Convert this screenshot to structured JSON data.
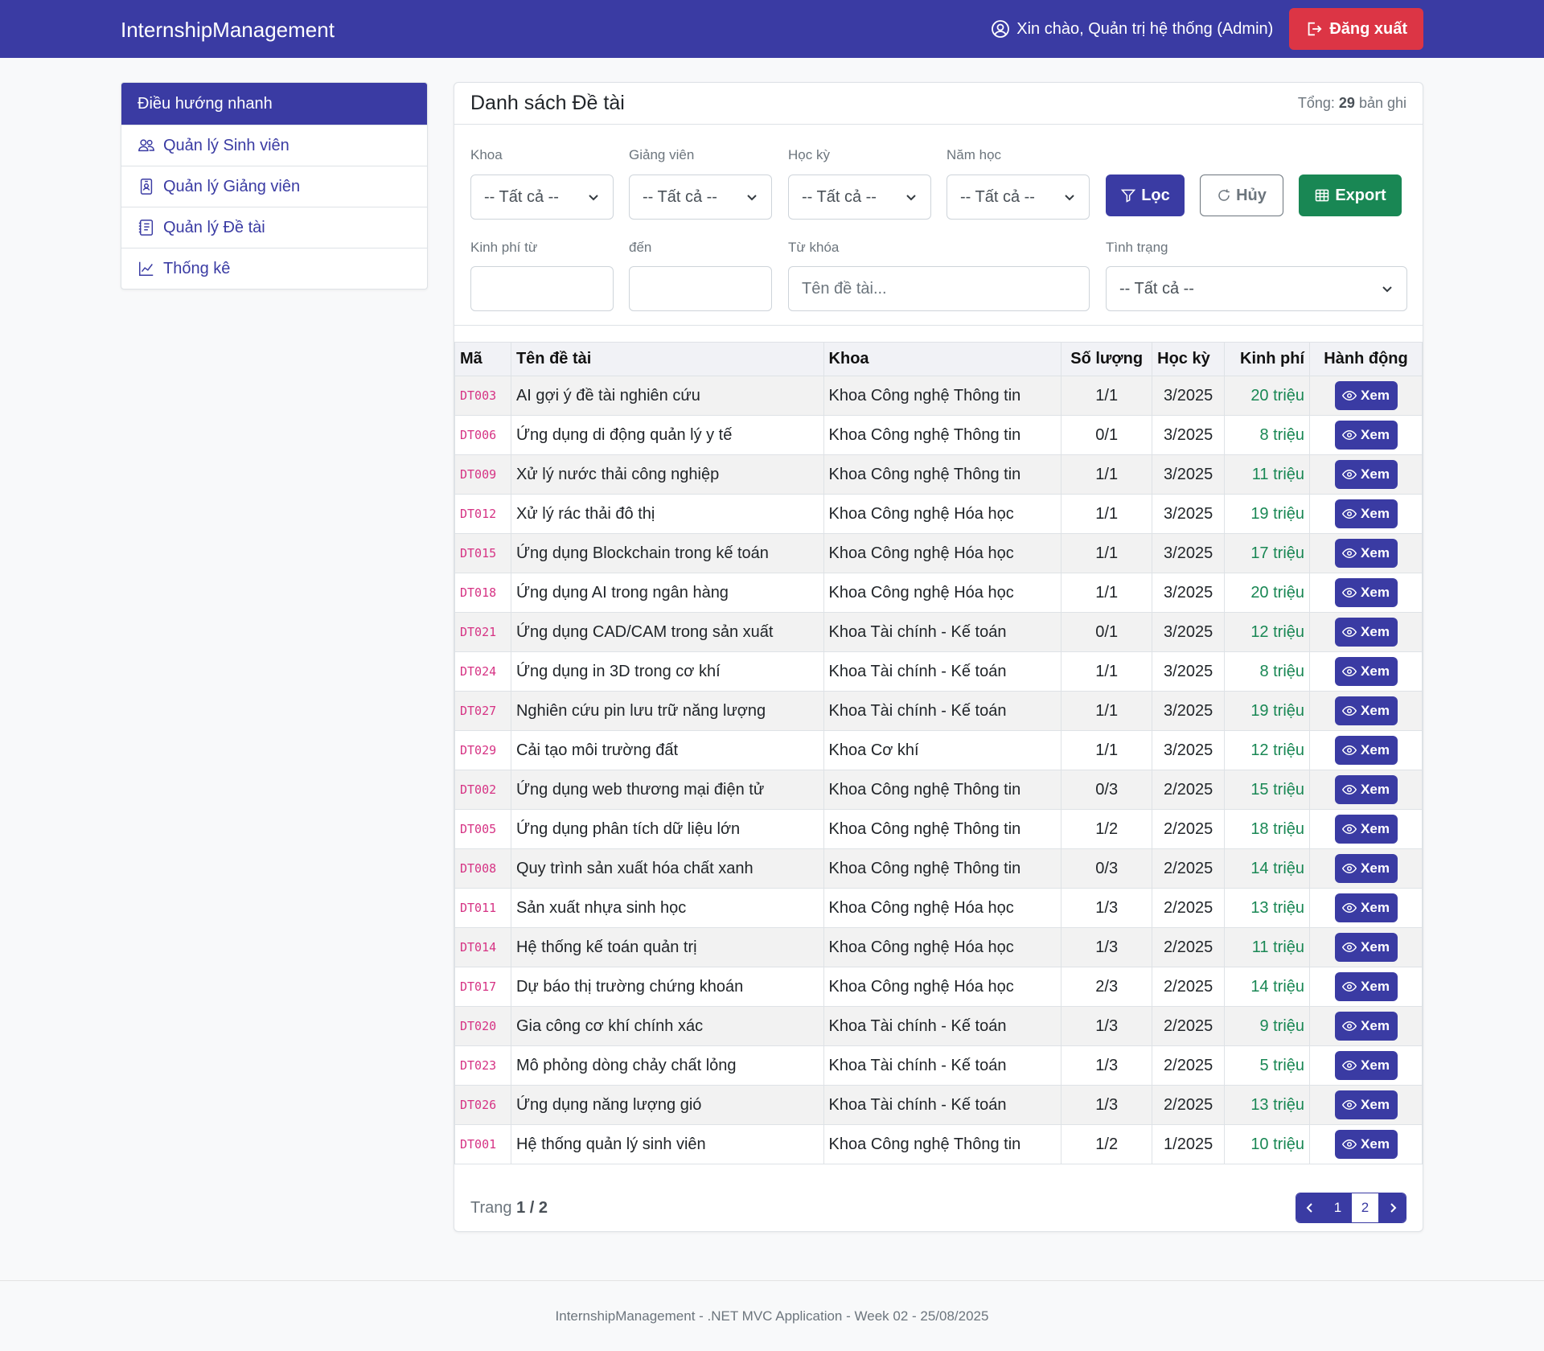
{
  "navbar": {
    "brand": "InternshipManagement",
    "greeting": "Xin chào, Quản trị hệ thống (Admin)",
    "logout_label": "Đăng xuất"
  },
  "sidebar": {
    "header": "Điều hướng nhanh",
    "items": [
      {
        "label": "Quản lý Sinh viên",
        "icon": "people-icon"
      },
      {
        "label": "Quản lý Giảng viên",
        "icon": "badge-icon"
      },
      {
        "label": "Quản lý Đề tài",
        "icon": "document-list-icon"
      },
      {
        "label": "Thống kê",
        "icon": "chart-line-icon"
      }
    ]
  },
  "card": {
    "title": "Danh sách Đề tài",
    "total_prefix": "Tổng:",
    "total_count": "29",
    "total_suffix": "bản ghi"
  },
  "filters": {
    "khoa": {
      "label": "Khoa",
      "value": "-- Tất cả --"
    },
    "giangvien": {
      "label": "Giảng viên",
      "value": "-- Tất cả --"
    },
    "hocky": {
      "label": "Học kỳ",
      "value": "-- Tất cả --"
    },
    "namhoc": {
      "label": "Năm học",
      "value": "-- Tất cả --"
    },
    "kinhphi_tu": {
      "label": "Kinh phí từ",
      "value": ""
    },
    "den": {
      "label": "đến",
      "value": ""
    },
    "tukhoa": {
      "label": "Từ khóa",
      "placeholder": "Tên đề tài..."
    },
    "tinhtrang": {
      "label": "Tình trạng",
      "value": "-- Tất cả --"
    },
    "btn_loc": "Lọc",
    "btn_huy": "Hủy",
    "btn_export": "Export"
  },
  "table": {
    "headers": [
      "Mã",
      "Tên đề tài",
      "Khoa",
      "Số lượng",
      "Học kỳ",
      "Kinh phí",
      "Hành động"
    ],
    "view_label": "Xem",
    "rows": [
      {
        "code": "DT003",
        "name": "AI gợi ý đề tài nghiên cứu",
        "faculty": "Khoa Công nghệ Thông tin",
        "qty": "1/1",
        "term": "3/2025",
        "cost": "20 triệu"
      },
      {
        "code": "DT006",
        "name": "Ứng dụng di động quản lý y tế",
        "faculty": "Khoa Công nghệ Thông tin",
        "qty": "0/1",
        "term": "3/2025",
        "cost": "8 triệu"
      },
      {
        "code": "DT009",
        "name": "Xử lý nước thải công nghiệp",
        "faculty": "Khoa Công nghệ Thông tin",
        "qty": "1/1",
        "term": "3/2025",
        "cost": "11 triệu"
      },
      {
        "code": "DT012",
        "name": "Xử lý rác thải đô thị",
        "faculty": "Khoa Công nghệ Hóa học",
        "qty": "1/1",
        "term": "3/2025",
        "cost": "19 triệu"
      },
      {
        "code": "DT015",
        "name": "Ứng dụng Blockchain trong kế toán",
        "faculty": "Khoa Công nghệ Hóa học",
        "qty": "1/1",
        "term": "3/2025",
        "cost": "17 triệu"
      },
      {
        "code": "DT018",
        "name": "Ứng dụng AI trong ngân hàng",
        "faculty": "Khoa Công nghệ Hóa học",
        "qty": "1/1",
        "term": "3/2025",
        "cost": "20 triệu"
      },
      {
        "code": "DT021",
        "name": "Ứng dụng CAD/CAM trong sản xuất",
        "faculty": "Khoa Tài chính - Kế toán",
        "qty": "0/1",
        "term": "3/2025",
        "cost": "12 triệu"
      },
      {
        "code": "DT024",
        "name": "Ứng dụng in 3D trong cơ khí",
        "faculty": "Khoa Tài chính - Kế toán",
        "qty": "1/1",
        "term": "3/2025",
        "cost": "8 triệu"
      },
      {
        "code": "DT027",
        "name": "Nghiên cứu pin lưu trữ năng lượng",
        "faculty": "Khoa Tài chính - Kế toán",
        "qty": "1/1",
        "term": "3/2025",
        "cost": "19 triệu"
      },
      {
        "code": "DT029",
        "name": "Cải tạo môi trường đất",
        "faculty": "Khoa Cơ khí",
        "qty": "1/1",
        "term": "3/2025",
        "cost": "12 triệu"
      },
      {
        "code": "DT002",
        "name": "Ứng dụng web thương mại điện tử",
        "faculty": "Khoa Công nghệ Thông tin",
        "qty": "0/3",
        "term": "2/2025",
        "cost": "15 triệu"
      },
      {
        "code": "DT005",
        "name": "Ứng dụng phân tích dữ liệu lớn",
        "faculty": "Khoa Công nghệ Thông tin",
        "qty": "1/2",
        "term": "2/2025",
        "cost": "18 triệu"
      },
      {
        "code": "DT008",
        "name": "Quy trình sản xuất hóa chất xanh",
        "faculty": "Khoa Công nghệ Thông tin",
        "qty": "0/3",
        "term": "2/2025",
        "cost": "14 triệu"
      },
      {
        "code": "DT011",
        "name": "Sản xuất nhựa sinh học",
        "faculty": "Khoa Công nghệ Hóa học",
        "qty": "1/3",
        "term": "2/2025",
        "cost": "13 triệu"
      },
      {
        "code": "DT014",
        "name": "Hệ thống kế toán quản trị",
        "faculty": "Khoa Công nghệ Hóa học",
        "qty": "1/3",
        "term": "2/2025",
        "cost": "11 triệu"
      },
      {
        "code": "DT017",
        "name": "Dự báo thị trường chứng khoán",
        "faculty": "Khoa Công nghệ Hóa học",
        "qty": "2/3",
        "term": "2/2025",
        "cost": "14 triệu"
      },
      {
        "code": "DT020",
        "name": "Gia công cơ khí chính xác",
        "faculty": "Khoa Tài chính - Kế toán",
        "qty": "1/3",
        "term": "2/2025",
        "cost": "9 triệu"
      },
      {
        "code": "DT023",
        "name": "Mô phỏng dòng chảy chất lỏng",
        "faculty": "Khoa Tài chính - Kế toán",
        "qty": "1/3",
        "term": "2/2025",
        "cost": "5 triệu"
      },
      {
        "code": "DT026",
        "name": "Ứng dụng năng lượng gió",
        "faculty": "Khoa Tài chính - Kế toán",
        "qty": "1/3",
        "term": "2/2025",
        "cost": "13 triệu"
      },
      {
        "code": "DT001",
        "name": "Hệ thống quản lý sinh viên",
        "faculty": "Khoa Công nghệ Thông tin",
        "qty": "1/2",
        "term": "1/2025",
        "cost": "10 triệu"
      }
    ]
  },
  "pagination": {
    "label": "Trang",
    "current": "1",
    "separator": "/",
    "total": "2",
    "pages": [
      "1",
      "2"
    ]
  },
  "footer": {
    "text": "InternshipManagement - .NET MVC Application - Week 02 - 25/08/2025"
  },
  "colors": {
    "primary": "#3a3ba3",
    "danger": "#dc3545",
    "success": "#198754",
    "code_pink": "#d63384"
  }
}
